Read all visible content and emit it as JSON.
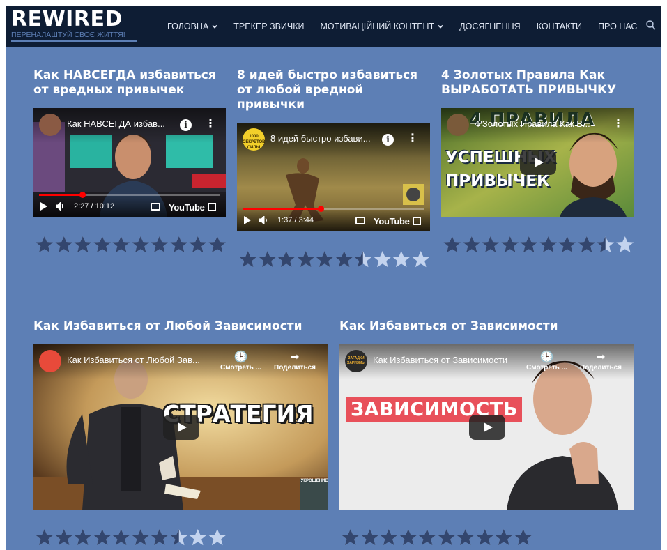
{
  "header": {
    "logo_title": "REWIRED",
    "logo_tagline": "ПЕРЕНАЛАШТУЙ СВОЄ ЖИТТЯ!",
    "nav": [
      {
        "label": "ГОЛОВНА",
        "has_dropdown": true
      },
      {
        "label": "ТРЕКЕР ЗВИЧКИ",
        "has_dropdown": false
      },
      {
        "label": "МОТИВАЦІЙНИЙ КОНТЕНТ",
        "has_dropdown": true
      },
      {
        "label": "ДОСЯГНЕННЯ",
        "has_dropdown": false
      },
      {
        "label": "КОНТАКТИ",
        "has_dropdown": false
      },
      {
        "label": "ПРО НАС",
        "has_dropdown": false
      }
    ],
    "search_icon": "search-icon"
  },
  "colors": {
    "page_bg": "#5d7fb5",
    "header_bg": "#0e1d34",
    "star_filled": "#33466e",
    "star_empty": "#c3d3ee",
    "progress": "#ff0000"
  },
  "videos": [
    {
      "title": "Как НАВСЕГДА избавиться от вредных привычек",
      "embed_title": "Как НАВСЕГДА избав...",
      "time": "2:27 / 10:12",
      "progress": 0.24,
      "youtube_label": "YouTube",
      "rating": 10,
      "rating_max": 10
    },
    {
      "title": "8 идей быстро избавиться от любой вредной привычки",
      "embed_title": "8 идей быстро избави...",
      "channel_badge": "1000 СЕКРЕТОВ СИЛЫ",
      "time": "1:37 / 3:44",
      "progress": 0.43,
      "youtube_label": "YouTube",
      "rating": 6.5,
      "rating_max": 10
    },
    {
      "title": "4 Золотых Правила Как ВЫРАБОТАТЬ ПРИВЫЧКУ",
      "embed_title": "4 Золотых Правила Как В...",
      "thumb_text_top": "4 ПРАВИЛА",
      "thumb_text_mid": "УСПЕШНЫХ",
      "thumb_text_bottom": "ПРИВЫЧЕК",
      "rating": 8.5,
      "rating_max": 10
    },
    {
      "title": "Как Избавиться от Любой Зависимости",
      "embed_title": "Как Избавиться от Любой Зав...",
      "thumb_text": "СТРАТЕГИЯ",
      "corner_badge": "УКРОЩЕНИЕ",
      "watch_later": "Смотреть ...",
      "share": "Поделиться",
      "rating": 7.5,
      "rating_max": 10
    },
    {
      "title": "Как Избавиться от Зависимости",
      "embed_title": "Как Избавиться от Зависимости",
      "channel_badge": "ЗАГАДКИ ХАРИЗМЫ",
      "thumb_text": "ЗАВИСИМОСТЬ",
      "watch_later": "Смотреть ...",
      "share": "Поделиться",
      "rating": 10,
      "rating_max": 10
    }
  ]
}
